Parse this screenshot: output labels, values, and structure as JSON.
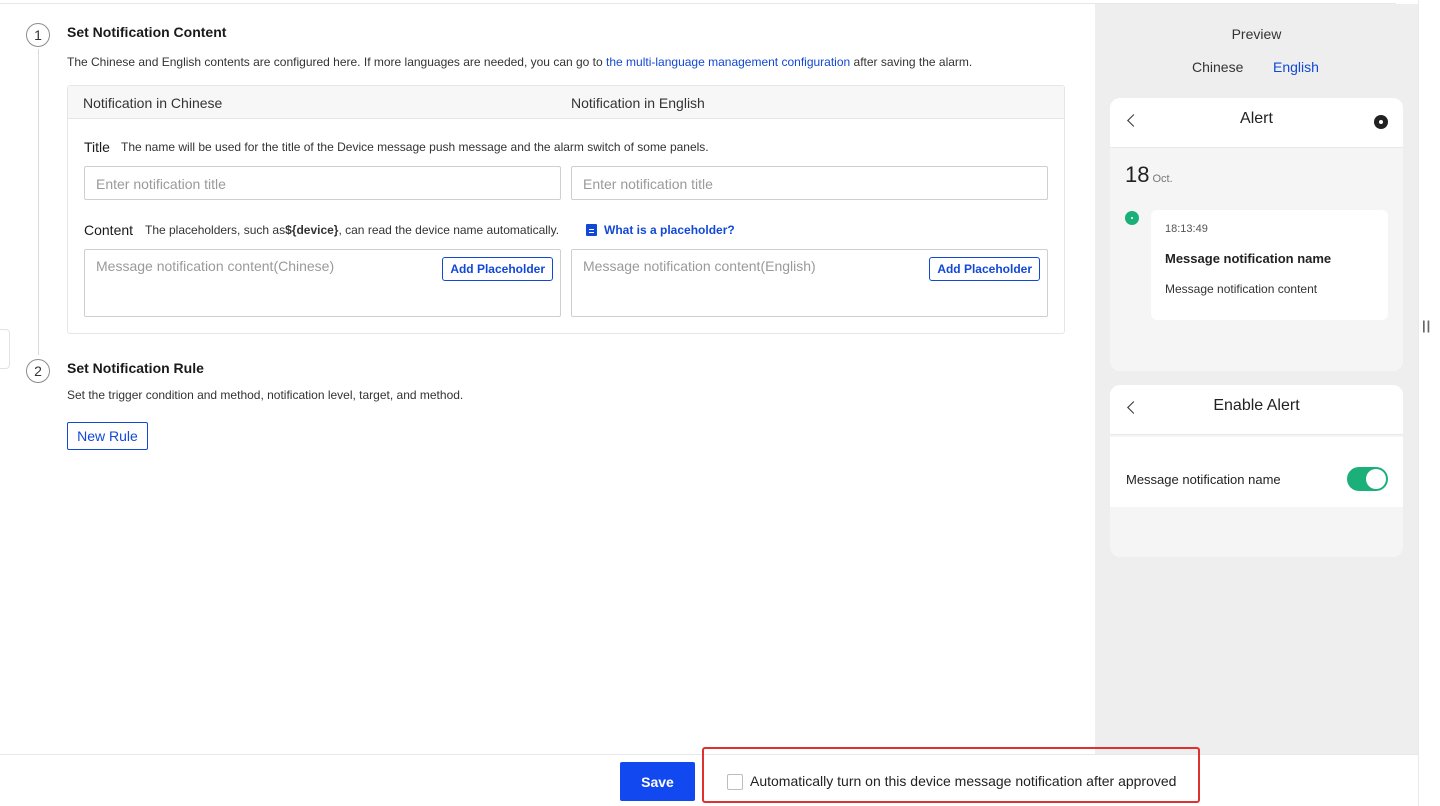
{
  "steps": [
    {
      "number": "1",
      "title": "Set Notification Content",
      "desc_before": "The Chinese and English contents are configured here. If more languages are needed, you can go to ",
      "desc_link": "the multi-language management configuration",
      "desc_after": " after saving the alarm."
    },
    {
      "number": "2",
      "title": "Set Notification Rule",
      "desc": "Set the trigger condition and method, notification level, target, and method.",
      "new_rule_label": "New Rule"
    }
  ],
  "content": {
    "col_chinese": "Notification in Chinese",
    "col_english": "Notification in English",
    "title_label": "Title",
    "title_hint": "The name will be used for the title of the Device message push message and the alarm switch of some panels.",
    "title_placeholder_cn": "Enter notification title",
    "title_placeholder_en": "Enter notification title",
    "content_label": "Content",
    "content_hint_before": "The placeholders, such as",
    "content_hint_code": "${device}",
    "content_hint_after": ", can read the device name automatically.",
    "help_link": "What is a placeholder?",
    "content_placeholder_cn": "Message notification content(Chinese)",
    "content_placeholder_en": "Message notification content(English)",
    "add_placeholder": "Add Placeholder"
  },
  "preview": {
    "title": "Preview",
    "tabs": [
      "Chinese",
      "English"
    ],
    "active_tab": "English",
    "alert_card": {
      "title": "Alert",
      "day": "18",
      "month": "Oct.",
      "time": "18:13:49",
      "name": "Message notification name",
      "content": "Message notification content"
    },
    "enable_card": {
      "title": "Enable Alert",
      "label": "Message notification name",
      "toggle_on": true
    }
  },
  "footer": {
    "save_label": "Save",
    "auto_label": "Automatically turn on this device message notification after approved",
    "auto_checked": false
  },
  "colors": {
    "primary": "#1248d6",
    "save": "#1248f0",
    "toggle": "#1bb079",
    "highlight": "#e03131"
  }
}
